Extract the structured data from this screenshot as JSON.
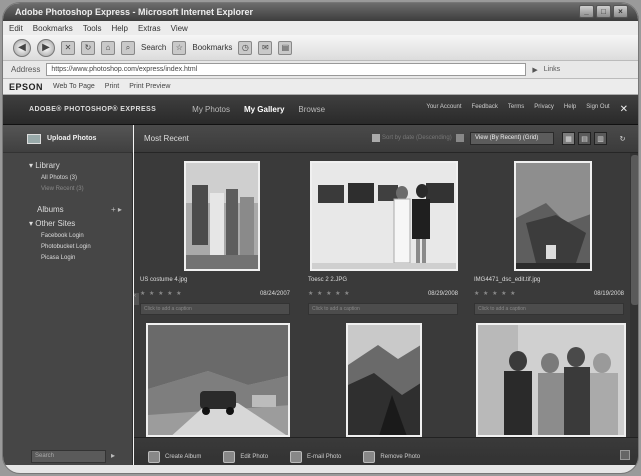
{
  "browser": {
    "title": "Adobe Photoshop Express - Microsoft Internet Explorer",
    "menu": [
      "Edit",
      "Bookmarks",
      "Tools",
      "Help",
      "Extras",
      "View"
    ],
    "toolbar": {
      "search_label": "Search",
      "bookmarks_label": "Bookmarks"
    },
    "address": "https://www.photoshop.com/express/index.html",
    "address_label": "Address",
    "links_label": "Links",
    "links": {
      "brand": "EPSON",
      "web_to_page": "Web To Page",
      "print": "Print",
      "print_preview": "Print Preview"
    }
  },
  "app": {
    "brand": "ADOBE® PHOTOSHOP® EXPRESS",
    "nav": [
      "My Photos",
      "My Gallery",
      "Browse"
    ],
    "account": [
      "Your Account",
      "Feedback",
      "Terms",
      "Privacy",
      "Help",
      "Sign Out"
    ]
  },
  "sidebar": {
    "upload_label": "Upload Photos",
    "library": {
      "label": "Library",
      "items": [
        "All Photos (3)",
        "View Recent (3)"
      ]
    },
    "albums_label": "Albums",
    "other_sites": {
      "label": "Other Sites",
      "items": [
        "Facebook Login",
        "Photobucket Login",
        "Picasa Login"
      ]
    },
    "search_placeholder": "Search"
  },
  "main": {
    "sort_title": "Most Recent",
    "sort_note": "Sort by date (Descending)",
    "view_option": "View (By Recent) (Grid)",
    "tiles": [
      {
        "name": "US costume 4.jpg",
        "date": "08/24/2007",
        "stars": "★ ★ ★ ★ ★",
        "caption": "Click to add a caption"
      },
      {
        "name": "Toesc 2 2.JPG",
        "date": "08/29/2008",
        "stars": "★ ★ ★ ★ ★",
        "caption": "Click to add a caption"
      },
      {
        "name": "IMG4471_dsc_edit.tif.jpg",
        "date": "08/19/2008",
        "stars": "★ ★ ★ ★ ★",
        "caption": "Click to add a caption"
      }
    ]
  },
  "bottombar": [
    "Create Album",
    "Edit Photo",
    "E-mail Photo",
    "Remove Photo"
  ],
  "colors": {
    "app_bg": "#3a3a3a",
    "sidebar_bg": "#464646",
    "header_bg": "#2f2f2f",
    "photo_border": "#f0f0f0"
  }
}
